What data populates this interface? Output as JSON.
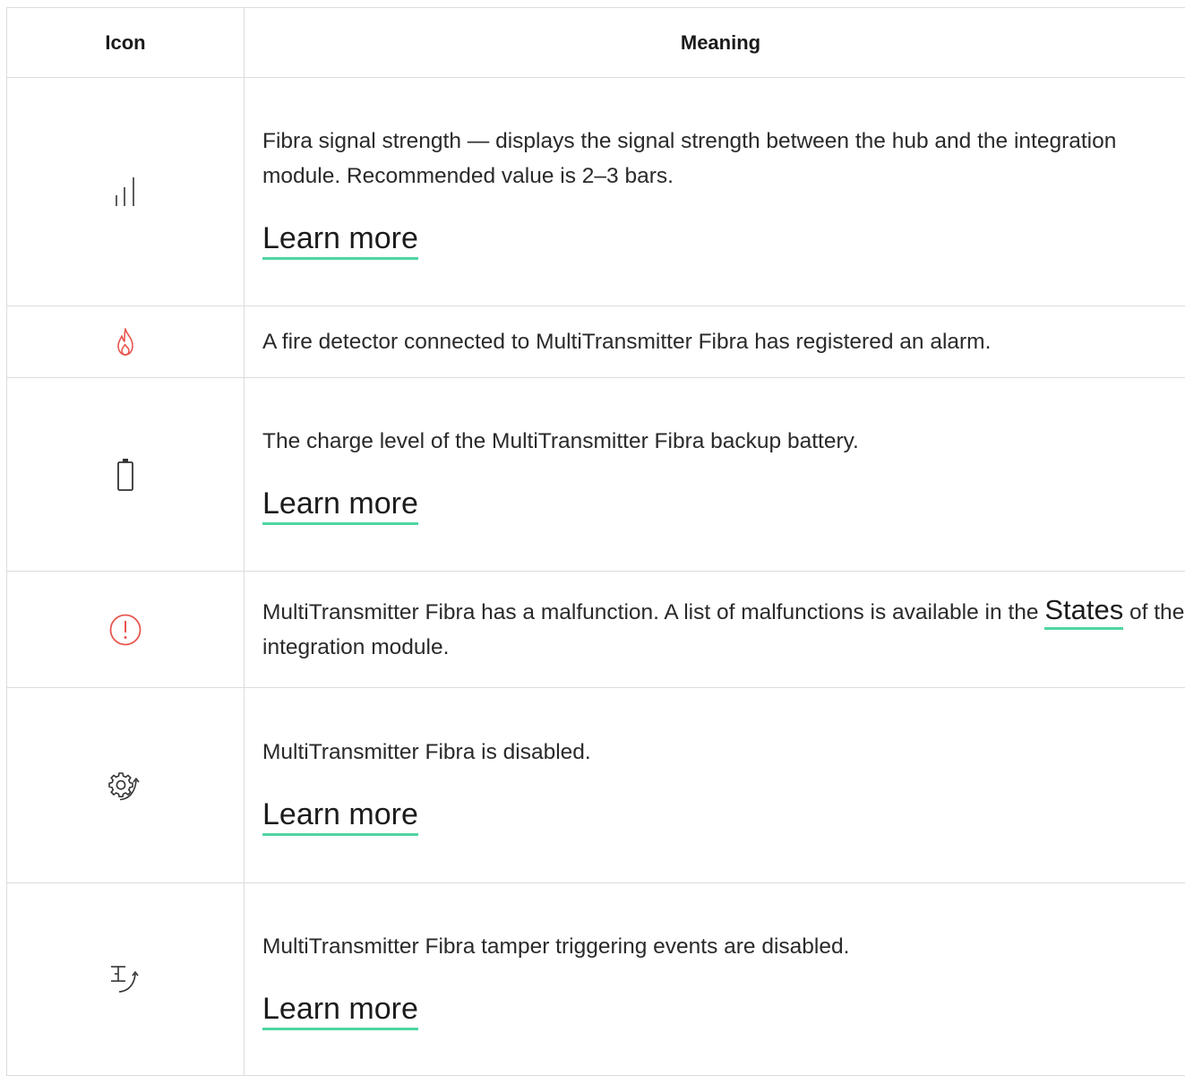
{
  "table": {
    "headers": {
      "icon": "Icon",
      "meaning": "Meaning"
    },
    "rows": [
      {
        "icon": "signal-strength-icon",
        "text": "Fibra signal strength — displays the signal strength between the hub and the integration module. Recommended value is 2–3 bars.",
        "link": "Learn more"
      },
      {
        "icon": "fire-icon",
        "text": "A fire detector connected to MultiTransmitter Fibra has registered an alarm."
      },
      {
        "icon": "battery-icon",
        "text": "The charge level of the MultiTransmitter Fibra backup battery.",
        "link": "Learn more"
      },
      {
        "icon": "malfunction-icon",
        "text_before": "MultiTransmitter Fibra has a malfunction. A list of malfunctions is available in the",
        "inline_link": "States",
        "text_after": "of the integration module."
      },
      {
        "icon": "device-disabled-icon",
        "text": "MultiTransmitter Fibra is disabled.",
        "link": "Learn more"
      },
      {
        "icon": "tamper-disabled-icon",
        "text": "MultiTransmitter Fibra tamper triggering events are disabled.",
        "link": "Learn more"
      }
    ]
  },
  "colors": {
    "accent_underline": "#4fd6a0",
    "alert_red": "#e8554e",
    "border": "#dcdcdc"
  }
}
